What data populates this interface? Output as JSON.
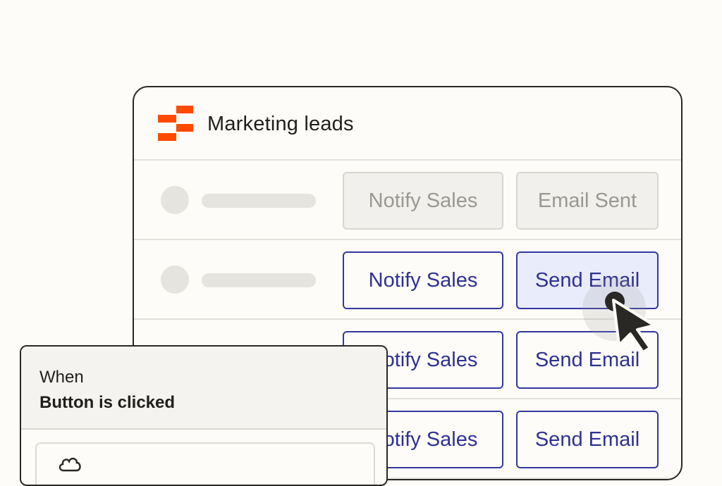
{
  "panel": {
    "title": "Marketing leads",
    "brand_color": "#ff4a00"
  },
  "rows": [
    {
      "state": "disabled",
      "button1": "Notify Sales",
      "button2": "Email Sent"
    },
    {
      "state": "active",
      "button1": "Notify Sales",
      "button2": "Send Email"
    },
    {
      "state": "default",
      "button1": "Notify Sales",
      "button2": "Send Email"
    },
    {
      "state": "default",
      "button1": "Notify Sales",
      "button2": "Send Email"
    }
  ],
  "trigger": {
    "when_label": "When",
    "event_label": "Button is clicked",
    "step_icon": "cloud-icon"
  },
  "colors": {
    "accent": "#3437a0",
    "accent_text": "#2e3192",
    "active_bg": "#e9ecfb",
    "disabled_text": "#9a9893",
    "background": "#fdfcf8"
  },
  "cursor_icon": "arrow-pointer-icon"
}
